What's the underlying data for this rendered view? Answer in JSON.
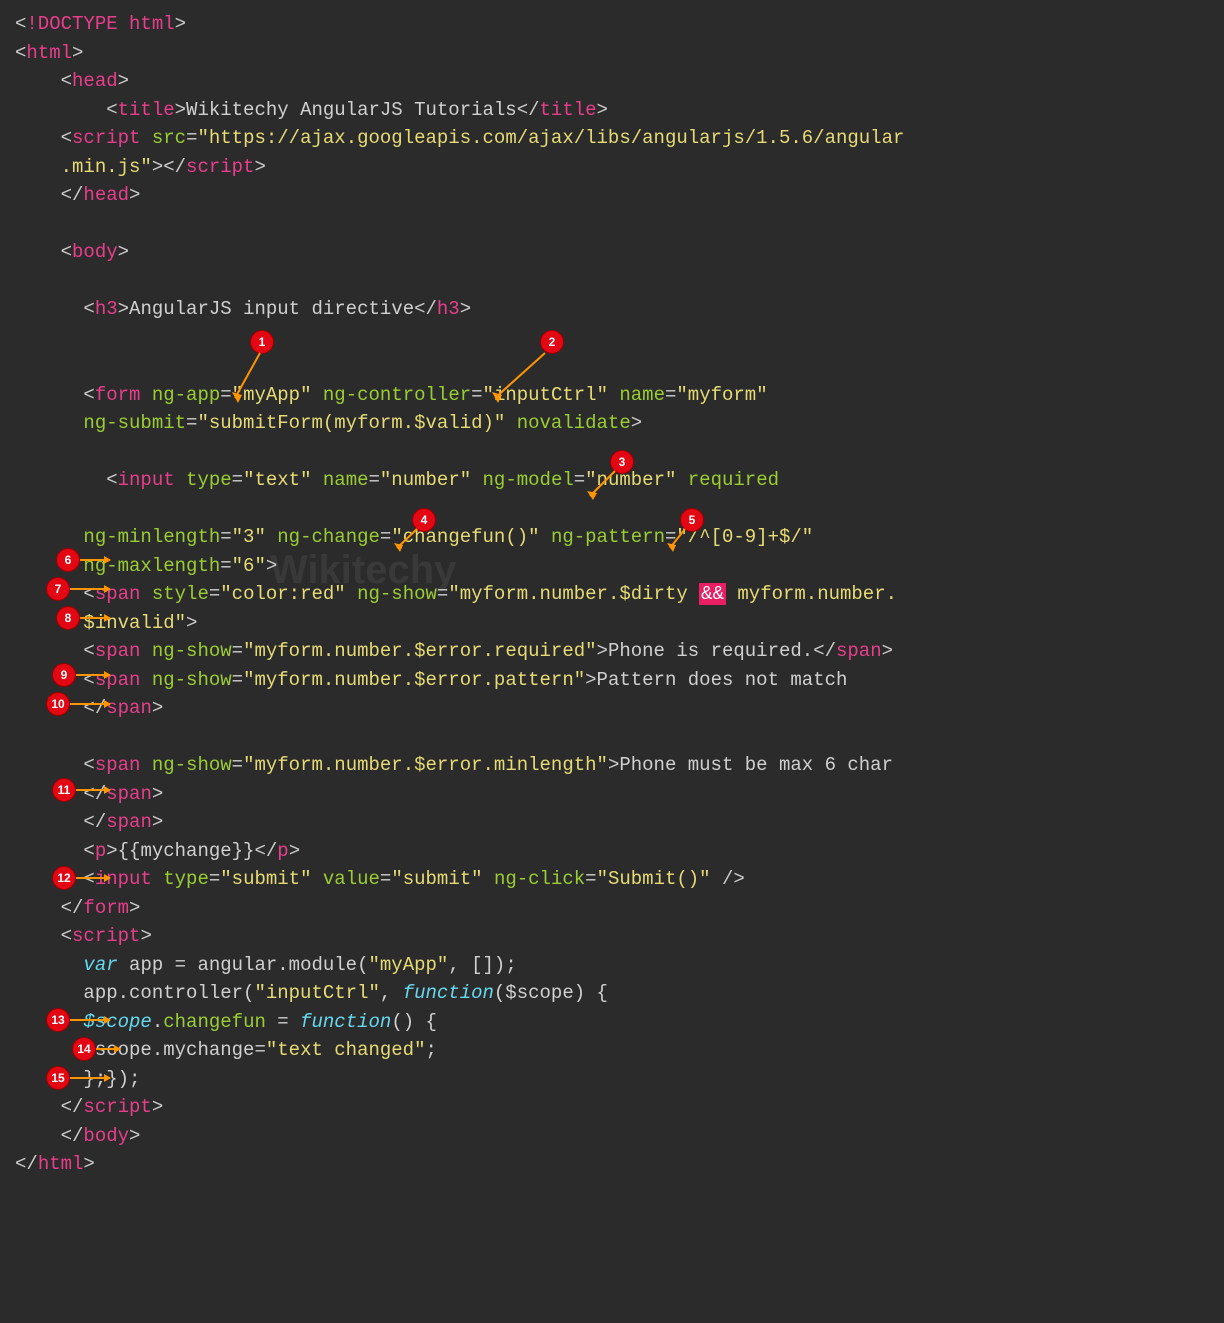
{
  "code": {
    "l1": {
      "b1": "<",
      "t1": "!DOCTYPE html",
      "b2": ">"
    },
    "l2": {
      "b1": "<",
      "t1": "html",
      "b2": ">"
    },
    "l3": {
      "b1": "<",
      "t1": "head",
      "b2": ">"
    },
    "l4": {
      "b1": "<",
      "t1": "title",
      "b2": ">",
      "txt": "Wikitechy AngularJS Tutorials",
      "b3": "</",
      "t2": "title",
      "b4": ">"
    },
    "l5": {
      "b1": "<",
      "t1": "script",
      "sp": " ",
      "a1": "src",
      "eq": "=",
      "s1": "\"https://ajax.googleapis.com/ajax/libs/angularjs/1.5.6/angular"
    },
    "l5b": {
      "s1": ".min.js\"",
      "b1": "></",
      "t1": "script",
      "b2": ">"
    },
    "l6": {
      "b1": "</",
      "t1": "head",
      "b2": ">"
    },
    "l7": {
      "b1": "<",
      "t1": "body",
      "b2": ">"
    },
    "l8": {
      "b1": "<",
      "t1": "h3",
      "b2": ">",
      "txt": "AngularJS input directive",
      "b3": "</",
      "t2": "h3",
      "b4": ">"
    },
    "l9": {
      "b1": "<",
      "t1": "form",
      "sp": " ",
      "a1": "ng-app",
      "eq": "=",
      "s1": "\"myApp\"",
      "sp2": " ",
      "a2": "ng-controller",
      "eq2": "=",
      "s2": "\"inputCtrl\"",
      "sp3": " ",
      "a3": "name",
      "eq3": "=",
      "s3": "\"myform\""
    },
    "l10": {
      "a1": "ng-submit",
      "eq": "=",
      "s1": "\"submitForm(myform.$valid)\"",
      "sp": " ",
      "a2": "novalidate",
      "b1": ">"
    },
    "l11": {
      "b1": "<",
      "t1": "input",
      "sp": " ",
      "a1": "type",
      "eq": "=",
      "s1": "\"text\"",
      "sp2": " ",
      "a2": "name",
      "eq2": "=",
      "s2": "\"number\"",
      "sp3": " ",
      "a3": "ng-model",
      "eq3": "=",
      "s3": "\"number\"",
      "sp4": " ",
      "a4": "required"
    },
    "l12": {
      "a1": "ng-minlength",
      "eq": "=",
      "s1": "\"3\"",
      "sp": " ",
      "a2": "ng-change",
      "eq2": "=",
      "s2": "\"changefun()\"",
      "sp2": " ",
      "a3": "ng-pattern",
      "eq3": "=",
      "s3": "\"/^[0-9]+$/\""
    },
    "l13": {
      "a1": "ng-maxlength",
      "eq": "=",
      "s1": "\"6\"",
      "b1": ">"
    },
    "l14": {
      "b1": "<",
      "t1": "span",
      "sp": " ",
      "a1": "style",
      "eq": "=",
      "s1": "\"color:red\"",
      "sp2": " ",
      "a2": "ng-show",
      "eq2": "=",
      "s2a": "\"myform.number.$dirty ",
      "amp": "&&",
      "s2b": " myform.number."
    },
    "l14b": {
      "s1": "$invalid\"",
      "b1": ">"
    },
    "l15": {
      "b1": "<",
      "t1": "span",
      "sp": " ",
      "a1": "ng-show",
      "eq": "=",
      "s1": "\"myform.number.$error.required\"",
      "b2": ">",
      "txt": "Phone is required.",
      "b3": "</",
      "t2": "span",
      "b4": ">"
    },
    "l16": {
      "b1": "<",
      "t1": "span",
      "sp": " ",
      "a1": "ng-show",
      "eq": "=",
      "s1": "\"myform.number.$error.pattern\"",
      "b2": ">",
      "txt": "Pattern does not match"
    },
    "l16b": {
      "b1": "</",
      "t1": "span",
      "b2": ">"
    },
    "l17": {
      "b1": "<",
      "t1": "span",
      "sp": " ",
      "a1": "ng-show",
      "eq": "=",
      "s1": "\"myform.number.$error.minlength\"",
      "b2": ">",
      "txt": "Phone must be max 6 char"
    },
    "l17b": {
      "b1": "</",
      "t1": "span",
      "b2": ">"
    },
    "l17c": {
      "b1": "</",
      "t1": "span",
      "b2": ">"
    },
    "l18": {
      "b1": "<",
      "t1": "p",
      "b2": ">",
      "txt": "{{mychange}}",
      "b3": "</",
      "t2": "p",
      "b4": ">"
    },
    "l19": {
      "b1": "<",
      "t1": "input",
      "sp": " ",
      "a1": "type",
      "eq": "=",
      "s1": "\"submit\"",
      "sp2": " ",
      "a2": "value",
      "eq2": "=",
      "s2": "\"submit\"",
      "sp3": " ",
      "a3": "ng-click",
      "eq3": "=",
      "s3": "\"Submit()\"",
      "sp4": " ",
      "b2": "/>"
    },
    "l20": {
      "b1": "</",
      "t1": "form",
      "b2": ">"
    },
    "l21": {
      "b1": "<",
      "t1": "script",
      "b2": ">"
    },
    "l22": {
      "k1": "var",
      "sp": " ",
      "v1": "app = angular.module(",
      "s1": "\"myApp\"",
      "v2": ", []);"
    },
    "l23": {
      "v1": "app.controller(",
      "s1": "\"inputCtrl\"",
      "v2": ", ",
      "k1": "function",
      "v3": "($scope) {"
    },
    "l24": {
      "k1": "$scope",
      "v1": ".",
      "f1": "changefun",
      "v2": " = ",
      "k2": "function",
      "v3": "() {"
    },
    "l25": {
      "v1": "$scope.mychange=",
      "s1": "\"text changed\"",
      "v2": ";"
    },
    "l26": {
      "v1": "};});"
    },
    "l27": {
      "b1": "</",
      "t1": "script",
      "b2": ">"
    },
    "l28": {
      "b1": "</",
      "t1": "body",
      "b2": ">"
    },
    "l29": {
      "b1": "</",
      "t1": "html",
      "b2": ">"
    }
  },
  "annotations": {
    "a1": "1",
    "a2": "2",
    "a3": "3",
    "a4": "4",
    "a5": "5",
    "a6": "6",
    "a7": "7",
    "a8": "8",
    "a9": "9",
    "a10": "10",
    "a11": "11",
    "a12": "12",
    "a13": "13",
    "a14": "14",
    "a15": "15"
  },
  "watermark": "Wikitechy"
}
